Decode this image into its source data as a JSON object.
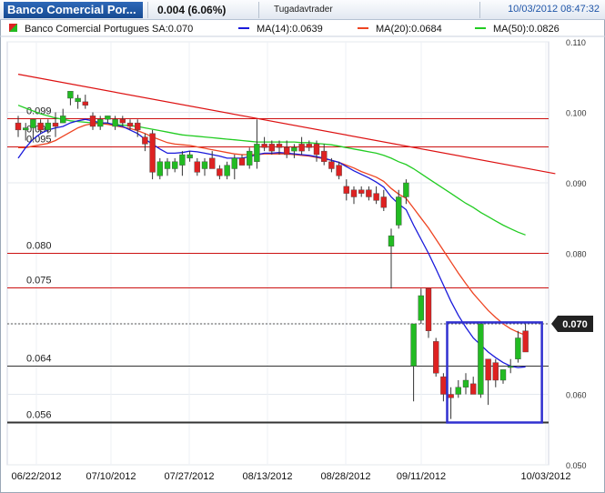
{
  "header": {
    "instrument": "Banco Comercial Por...",
    "change": "0.004 (6.06%)",
    "brand": "Tugadavtrader",
    "datetime": "10/03/2012 08:47:32"
  },
  "legend": {
    "main": "Banco Comercial Portugues SA:0.070",
    "ma14": "MA(14):0.0639",
    "ma20": "MA(20):0.0684",
    "ma50": "MA(50):0.0826"
  },
  "colors": {
    "up": "#22bb22",
    "down": "#dd2222",
    "ma14": "#1a1adb",
    "ma20": "#ee4422",
    "ma50": "#22cc22",
    "hline": "#cc1111",
    "box": "#3030d0",
    "trend": "#dd1111"
  },
  "chart_data": {
    "type": "candlestick",
    "ylim": [
      0.05,
      0.11
    ],
    "yticks": [
      "0.110",
      "0.100",
      "0.090",
      "0.080",
      "0.070",
      "0.060",
      "0.050"
    ],
    "xticks": [
      "06/22/2012",
      "07/10/2012",
      "07/27/2012",
      "08/13/2012",
      "08/28/2012",
      "09/11/2012",
      "10/03/2012"
    ],
    "last_price": "0.070",
    "candles": [
      {
        "o": 0.0985,
        "h": 0.0995,
        "l": 0.0965,
        "c": 0.0975
      },
      {
        "o": 0.0975,
        "h": 0.0985,
        "l": 0.096,
        "c": 0.0978
      },
      {
        "o": 0.0978,
        "h": 0.099,
        "l": 0.096,
        "c": 0.099
      },
      {
        "o": 0.0985,
        "h": 0.099,
        "l": 0.097,
        "c": 0.0975
      },
      {
        "o": 0.0975,
        "h": 0.099,
        "l": 0.097,
        "c": 0.0985
      },
      {
        "o": 0.0985,
        "h": 0.1,
        "l": 0.0965,
        "c": 0.098
      },
      {
        "o": 0.0985,
        "h": 0.1005,
        "l": 0.0985,
        "c": 0.0995
      },
      {
        "o": 0.102,
        "h": 0.103,
        "l": 0.101,
        "c": 0.103
      },
      {
        "o": 0.1015,
        "h": 0.1025,
        "l": 0.1005,
        "c": 0.102
      },
      {
        "o": 0.1015,
        "h": 0.1025,
        "l": 0.1005,
        "c": 0.101
      },
      {
        "o": 0.0995,
        "h": 0.1,
        "l": 0.0975,
        "c": 0.098
      },
      {
        "o": 0.098,
        "h": 0.0995,
        "l": 0.0975,
        "c": 0.099
      },
      {
        "o": 0.099,
        "h": 0.0995,
        "l": 0.0985,
        "c": 0.0995
      },
      {
        "o": 0.098,
        "h": 0.0995,
        "l": 0.0975,
        "c": 0.099
      },
      {
        "o": 0.099,
        "h": 0.0995,
        "l": 0.098,
        "c": 0.0985
      },
      {
        "o": 0.0985,
        "h": 0.099,
        "l": 0.0975,
        "c": 0.098
      },
      {
        "o": 0.0985,
        "h": 0.099,
        "l": 0.0965,
        "c": 0.0975
      },
      {
        "o": 0.0965,
        "h": 0.097,
        "l": 0.0945,
        "c": 0.0955
      },
      {
        "o": 0.097,
        "h": 0.0975,
        "l": 0.0905,
        "c": 0.0915
      },
      {
        "o": 0.091,
        "h": 0.0935,
        "l": 0.0905,
        "c": 0.093
      },
      {
        "o": 0.092,
        "h": 0.0935,
        "l": 0.091,
        "c": 0.093
      },
      {
        "o": 0.092,
        "h": 0.0935,
        "l": 0.0915,
        "c": 0.093
      },
      {
        "o": 0.0925,
        "h": 0.0945,
        "l": 0.091,
        "c": 0.094
      },
      {
        "o": 0.0935,
        "h": 0.0945,
        "l": 0.093,
        "c": 0.094
      },
      {
        "o": 0.093,
        "h": 0.0935,
        "l": 0.091,
        "c": 0.0915
      },
      {
        "o": 0.092,
        "h": 0.0935,
        "l": 0.091,
        "c": 0.093
      },
      {
        "o": 0.0935,
        "h": 0.0945,
        "l": 0.092,
        "c": 0.092
      },
      {
        "o": 0.092,
        "h": 0.0925,
        "l": 0.0905,
        "c": 0.091
      },
      {
        "o": 0.091,
        "h": 0.093,
        "l": 0.0905,
        "c": 0.0925
      },
      {
        "o": 0.092,
        "h": 0.094,
        "l": 0.0905,
        "c": 0.0935
      },
      {
        "o": 0.0935,
        "h": 0.094,
        "l": 0.0925,
        "c": 0.0925
      },
      {
        "o": 0.0925,
        "h": 0.095,
        "l": 0.092,
        "c": 0.0945
      },
      {
        "o": 0.093,
        "h": 0.099,
        "l": 0.092,
        "c": 0.0955
      },
      {
        "o": 0.0955,
        "h": 0.0965,
        "l": 0.0945,
        "c": 0.095
      },
      {
        "o": 0.0955,
        "h": 0.096,
        "l": 0.094,
        "c": 0.0945
      },
      {
        "o": 0.0955,
        "h": 0.096,
        "l": 0.094,
        "c": 0.095
      },
      {
        "o": 0.095,
        "h": 0.096,
        "l": 0.0935,
        "c": 0.094
      },
      {
        "o": 0.0945,
        "h": 0.0955,
        "l": 0.0935,
        "c": 0.095
      },
      {
        "o": 0.0955,
        "h": 0.0965,
        "l": 0.094,
        "c": 0.0945
      },
      {
        "o": 0.0955,
        "h": 0.096,
        "l": 0.0945,
        "c": 0.095
      },
      {
        "o": 0.0955,
        "h": 0.096,
        "l": 0.093,
        "c": 0.094
      },
      {
        "o": 0.0945,
        "h": 0.0955,
        "l": 0.0925,
        "c": 0.093
      },
      {
        "o": 0.093,
        "h": 0.0935,
        "l": 0.0915,
        "c": 0.092
      },
      {
        "o": 0.0925,
        "h": 0.093,
        "l": 0.0905,
        "c": 0.091
      },
      {
        "o": 0.0895,
        "h": 0.0905,
        "l": 0.0875,
        "c": 0.0885
      },
      {
        "o": 0.089,
        "h": 0.0895,
        "l": 0.087,
        "c": 0.088
      },
      {
        "o": 0.089,
        "h": 0.0895,
        "l": 0.088,
        "c": 0.0885
      },
      {
        "o": 0.089,
        "h": 0.0895,
        "l": 0.0875,
        "c": 0.088
      },
      {
        "o": 0.0885,
        "h": 0.0895,
        "l": 0.087,
        "c": 0.0875
      },
      {
        "o": 0.088,
        "h": 0.089,
        "l": 0.086,
        "c": 0.0865
      },
      {
        "o": 0.081,
        "h": 0.0835,
        "l": 0.075,
        "c": 0.0825
      },
      {
        "o": 0.084,
        "h": 0.089,
        "l": 0.0835,
        "c": 0.088
      },
      {
        "o": 0.088,
        "h": 0.0905,
        "l": 0.087,
        "c": 0.09
      },
      {
        "o": 0.064,
        "h": 0.07,
        "l": 0.059,
        "c": 0.07
      },
      {
        "o": 0.0705,
        "h": 0.075,
        "l": 0.07,
        "c": 0.074
      },
      {
        "o": 0.075,
        "h": 0.075,
        "l": 0.068,
        "c": 0.069
      },
      {
        "o": 0.0675,
        "h": 0.068,
        "l": 0.0625,
        "c": 0.063
      },
      {
        "o": 0.0625,
        "h": 0.063,
        "l": 0.059,
        "c": 0.06
      },
      {
        "o": 0.06,
        "h": 0.061,
        "l": 0.0565,
        "c": 0.0595
      },
      {
        "o": 0.06,
        "h": 0.062,
        "l": 0.0595,
        "c": 0.061
      },
      {
        "o": 0.061,
        "h": 0.063,
        "l": 0.06,
        "c": 0.062
      },
      {
        "o": 0.0615,
        "h": 0.0625,
        "l": 0.06,
        "c": 0.06
      },
      {
        "o": 0.06,
        "h": 0.07,
        "l": 0.0595,
        "c": 0.07
      },
      {
        "o": 0.065,
        "h": 0.065,
        "l": 0.0585,
        "c": 0.062
      },
      {
        "o": 0.0645,
        "h": 0.065,
        "l": 0.061,
        "c": 0.062
      },
      {
        "o": 0.062,
        "h": 0.0635,
        "l": 0.0615,
        "c": 0.0635
      },
      {
        "o": 0.064,
        "h": 0.065,
        "l": 0.063,
        "c": 0.064
      },
      {
        "o": 0.065,
        "h": 0.069,
        "l": 0.0645,
        "c": 0.068
      },
      {
        "o": 0.069,
        "h": 0.07,
        "l": 0.066,
        "c": 0.066
      }
    ],
    "ma14": [
      0.0935,
      0.095,
      0.0962,
      0.097,
      0.0975,
      0.0978,
      0.098,
      0.0985,
      0.0988,
      0.099,
      0.0988,
      0.0985,
      0.0985,
      0.0982,
      0.098,
      0.0975,
      0.097,
      0.0962,
      0.0955,
      0.0948,
      0.0942,
      0.0942,
      0.0943,
      0.0945,
      0.0944,
      0.0942,
      0.094,
      0.0938,
      0.0935,
      0.0935,
      0.0935,
      0.0937,
      0.094,
      0.0942,
      0.0942,
      0.0943,
      0.0942,
      0.0941,
      0.094,
      0.0939,
      0.0937,
      0.0935,
      0.0932,
      0.0929,
      0.0923,
      0.0917,
      0.0912,
      0.0907,
      0.0901,
      0.0894,
      0.088,
      0.087,
      0.0862,
      0.084,
      0.082,
      0.08,
      0.0778,
      0.0755,
      0.0732,
      0.0712,
      0.0695,
      0.068,
      0.067,
      0.066,
      0.0652,
      0.0645,
      0.064,
      0.0638,
      0.0639
    ],
    "ma20": [
      0.095,
      0.095,
      0.0952,
      0.0954,
      0.0956,
      0.096,
      0.0966,
      0.0972,
      0.0978,
      0.0982,
      0.0984,
      0.0984,
      0.0983,
      0.0981,
      0.0979,
      0.0977,
      0.0974,
      0.097,
      0.0965,
      0.0961,
      0.0957,
      0.0955,
      0.0954,
      0.0953,
      0.0951,
      0.0949,
      0.0947,
      0.0945,
      0.0943,
      0.0941,
      0.094,
      0.094,
      0.094,
      0.0941,
      0.0941,
      0.0941,
      0.0941,
      0.094,
      0.0939,
      0.0938,
      0.0936,
      0.0934,
      0.0932,
      0.0929,
      0.0925,
      0.0921,
      0.0916,
      0.0912,
      0.0908,
      0.0902,
      0.0892,
      0.0884,
      0.0878,
      0.0864,
      0.085,
      0.0836,
      0.082,
      0.0804,
      0.0788,
      0.0772,
      0.0757,
      0.0743,
      0.0731,
      0.0719,
      0.0709,
      0.07,
      0.0693,
      0.0688,
      0.0684
    ],
    "ma50": [
      0.101,
      0.1006,
      0.1002,
      0.0998,
      0.0995,
      0.0992,
      0.099,
      0.0988,
      0.0987,
      0.0986,
      0.0985,
      0.0985,
      0.0984,
      0.0983,
      0.0982,
      0.0981,
      0.098,
      0.0978,
      0.0976,
      0.0974,
      0.0972,
      0.097,
      0.0968,
      0.0967,
      0.0966,
      0.0965,
      0.0964,
      0.0963,
      0.0962,
      0.0961,
      0.096,
      0.0959,
      0.0958,
      0.0958,
      0.0958,
      0.0958,
      0.0958,
      0.0958,
      0.0957,
      0.0957,
      0.0956,
      0.0955,
      0.0954,
      0.0952,
      0.095,
      0.0948,
      0.0946,
      0.0944,
      0.0942,
      0.0939,
      0.0935,
      0.093,
      0.0926,
      0.092,
      0.0913,
      0.0906,
      0.0899,
      0.0892,
      0.0885,
      0.0878,
      0.0871,
      0.0865,
      0.0858,
      0.0852,
      0.0846,
      0.084,
      0.0835,
      0.083,
      0.0826
    ],
    "hlines": [
      {
        "value": 0.0991,
        "label": "0.099"
      },
      {
        "value": 0.0951,
        "label": "0.095"
      },
      {
        "value": 0.08,
        "label": "0.080"
      },
      {
        "value": 0.0751,
        "label": "0.075"
      },
      {
        "value": 0.064,
        "label": "0.064"
      },
      {
        "value": 0.056,
        "label": "0.056"
      }
    ],
    "dotted_line": 0.07,
    "trendline": [
      {
        "i": 0,
        "v": 0.1054
      },
      {
        "i": 72,
        "v": 0.0913
      }
    ],
    "box": {
      "i0": 57.5,
      "i1": 70.2,
      "v0": 0.0702,
      "v1": 0.056
    },
    "side_labels": [
      "0.096"
    ]
  }
}
